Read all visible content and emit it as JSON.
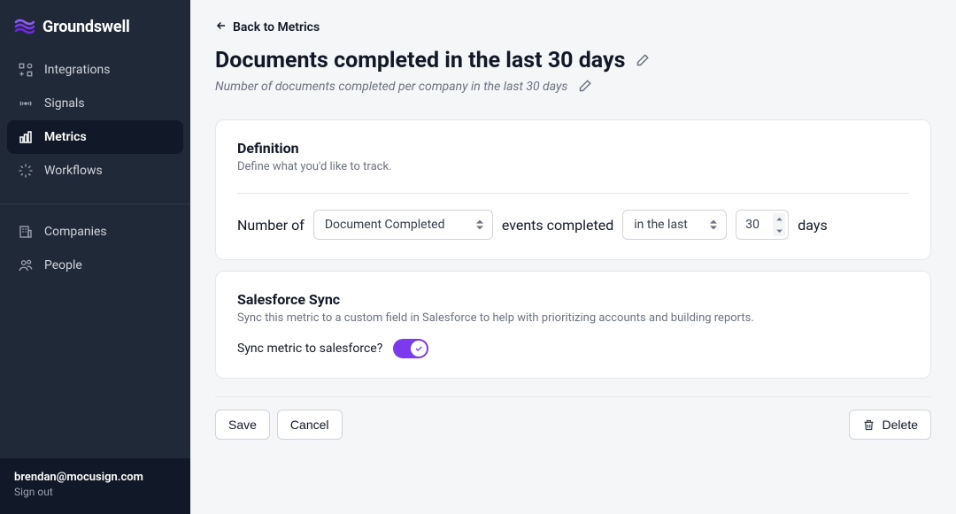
{
  "brand": {
    "name": "Groundswell"
  },
  "sidebar": {
    "items": [
      {
        "label": "Integrations"
      },
      {
        "label": "Signals"
      },
      {
        "label": "Metrics"
      },
      {
        "label": "Workflows"
      },
      {
        "label": "Companies"
      },
      {
        "label": "People"
      }
    ],
    "active_index": 2
  },
  "user": {
    "email": "brendan@mocusign.com",
    "sign_out_label": "Sign out"
  },
  "header": {
    "back_label": "Back to Metrics",
    "title": "Documents completed in the last 30 days",
    "subtitle": "Number of documents completed per company in the last 30 days"
  },
  "definition_card": {
    "title": "Definition",
    "description": "Define what you'd like to track.",
    "sentence": {
      "prefix": "Number of",
      "event_select": "Document Completed",
      "middle": "events completed",
      "window_select": "in the last",
      "days_value": "30",
      "suffix": "days"
    }
  },
  "salesforce_card": {
    "title": "Salesforce Sync",
    "description": "Sync this metric to a custom field in Salesforce to help with prioritizing accounts and building reports.",
    "toggle_label": "Sync metric to salesforce?",
    "toggle_on": true
  },
  "actions": {
    "save": "Save",
    "cancel": "Cancel",
    "delete": "Delete"
  }
}
